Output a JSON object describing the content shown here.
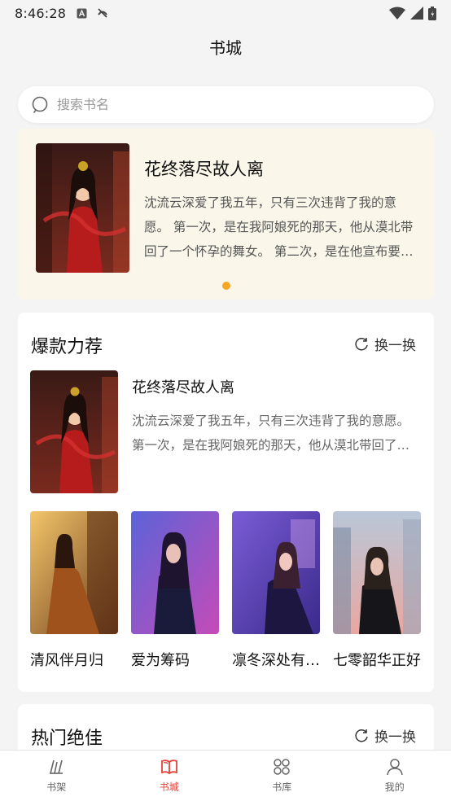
{
  "status_bar": {
    "time": "8:46:28",
    "icons": [
      "text-a-icon",
      "no-signal-icon",
      "wifi-icon",
      "cell-signal-icon",
      "battery-icon"
    ]
  },
  "header": {
    "title": "书城"
  },
  "search": {
    "placeholder": "搜索书名"
  },
  "banner": {
    "title": "花终落尽故人离",
    "description": "沈流云深爱了我五年，只有三次违背了我的意愿。 第一次，是在我阿娘死的那天，他从漠北带回了一个怀孕的舞女。 第二次，是在他宣布要立那个舞女为正妻的时候。",
    "active_dot_color": "#f5a623"
  },
  "recommend": {
    "title": "爆款力荐",
    "refresh_label": "换一换",
    "featured": {
      "title": "花终落尽故人离",
      "description": "沈流云深爱了我五年，只有三次违背了我的意愿。 第一次，是在我阿娘死的那天，他从漠北带回了一个怀孕的舞女。"
    },
    "grid": [
      {
        "title": "清风伴月归"
      },
      {
        "title": "爱为筹码"
      },
      {
        "title": "凛冬深处有暖阳"
      },
      {
        "title": "七零韶华正好"
      }
    ]
  },
  "hot": {
    "title": "热门绝佳",
    "refresh_label": "换一换"
  },
  "bottom_nav": [
    {
      "label": "书架",
      "icon": "bookshelf-icon",
      "active": false
    },
    {
      "label": "书城",
      "icon": "book-open-icon",
      "active": true
    },
    {
      "label": "书库",
      "icon": "grid-circles-icon",
      "active": false
    },
    {
      "label": "我的",
      "icon": "user-icon",
      "active": false
    }
  ],
  "colors": {
    "accent": "#e0443b",
    "banner_bg": "#fbf6ea",
    "dot": "#f5a623"
  }
}
